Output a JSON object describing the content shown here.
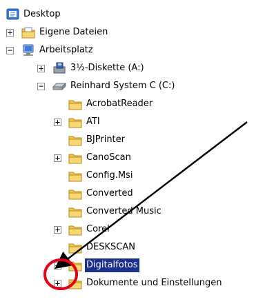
{
  "tree": {
    "items": [
      {
        "label": "Desktop",
        "icon": "desktop-icon"
      },
      {
        "label": "Eigene Dateien",
        "icon": "my-documents-folder-icon",
        "expander": "+"
      },
      {
        "label": "Arbeitsplatz",
        "icon": "my-computer-icon",
        "expander": "−"
      },
      {
        "label": "3½-Diskette (A:)",
        "icon": "floppy-drive-icon",
        "expander": "+"
      },
      {
        "label": "Reinhard System C (C:)",
        "icon": "hard-drive-icon",
        "expander": "−"
      },
      {
        "label": "AcrobatReader",
        "icon": "folder-icon"
      },
      {
        "label": "ATI",
        "icon": "folder-icon",
        "expander": "+"
      },
      {
        "label": "BJPrinter",
        "icon": "folder-icon"
      },
      {
        "label": "CanoScan",
        "icon": "folder-icon",
        "expander": "+"
      },
      {
        "label": "Config.Msi",
        "icon": "folder-icon"
      },
      {
        "label": "Converted",
        "icon": "folder-icon"
      },
      {
        "label": "Converted Music",
        "icon": "folder-icon"
      },
      {
        "label": "Corel",
        "icon": "folder-icon",
        "expander": "+"
      },
      {
        "label": "DESKSCAN",
        "icon": "folder-icon"
      },
      {
        "label": "Digitalfotos",
        "icon": "folder-icon",
        "expander": "+",
        "selected": true
      },
      {
        "label": "Dokumente und Einstellungen",
        "icon": "folder-icon",
        "expander": "+"
      }
    ]
  },
  "annotation": {
    "arrow_color": "#000000",
    "circle_color": "#e0001a"
  },
  "colors": {
    "folder": "#f2c94c",
    "selection": "#1b2f8c"
  }
}
